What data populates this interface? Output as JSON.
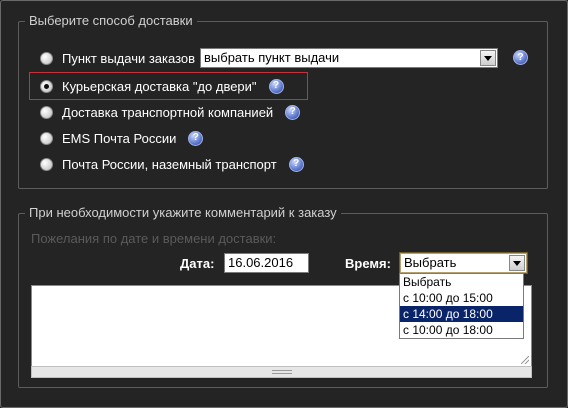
{
  "delivery": {
    "legend": "Выберите способ доставки",
    "options": [
      {
        "label": "Пункт выдачи заказов",
        "checked": false
      },
      {
        "label": "Курьерская доставка \"до двери\"",
        "checked": true
      },
      {
        "label": "Доставка транспортной компанией",
        "checked": false
      },
      {
        "label": "EMS Почта России",
        "checked": false
      },
      {
        "label": "Почта России, наземный транспорт",
        "checked": false
      }
    ],
    "pickup_select_value": "выбрать пункт выдачи",
    "help_glyph": "?"
  },
  "comment": {
    "legend": "При необходимости укажите комментарий к заказу",
    "hint": "Пожелания по дате и времени доставки:",
    "date_label": "Дата:",
    "date_value": "16.06.2016",
    "time_label": "Время:",
    "time_value": "Выбрать",
    "time_options": [
      "Выбрать",
      "с 10:00 до 15:00",
      "с 14:00 до 18:00",
      "с 10:00 до 18:00"
    ],
    "time_highlighted_index": 2
  },
  "colors": {
    "background": "#242424",
    "highlight_border": "#c8303a",
    "selected_option": "#0a246a",
    "help_icon": "#5873c8"
  },
  "icons": {
    "help": "help-question-icon",
    "dropdown": "chevron-down-icon",
    "resize": "resize-grip-icon"
  }
}
